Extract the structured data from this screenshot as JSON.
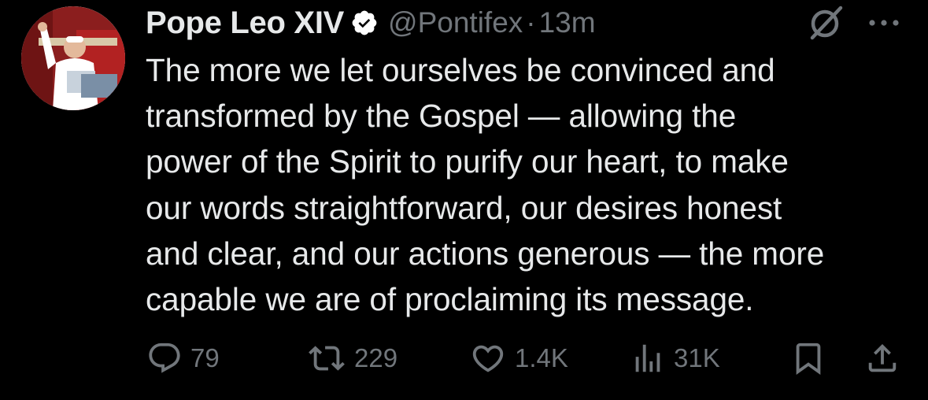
{
  "tweet": {
    "author": {
      "name": "Pope Leo XIV",
      "handle": "@Pontifex",
      "separator": "·",
      "time": "13m",
      "avatar_icon": "avatar-photo",
      "verified_icon": "verified-badge-icon"
    },
    "text_lines": [
      "The more we let ourselves be convinced and",
      "transformed by the Gospel — allowing the",
      "power of the Spirit to purify our heart, to make",
      "our words straightforward, our desires honest",
      "and clear, and our actions generous — the more",
      "capable we are of proclaiming its message."
    ],
    "actions": {
      "reply": {
        "icon": "reply-icon",
        "count": "79"
      },
      "retweet": {
        "icon": "retweet-icon",
        "count": "229"
      },
      "like": {
        "icon": "heart-icon",
        "count": "1.4K"
      },
      "views": {
        "icon": "analytics-icon",
        "count": "31K"
      },
      "bookmark": {
        "icon": "bookmark-icon"
      },
      "share": {
        "icon": "share-icon"
      }
    },
    "header_icons": {
      "grok": "grok-icon",
      "more": "more-icon"
    }
  },
  "colors": {
    "background": "#000000",
    "primary_text": "#e7e9ea",
    "secondary_text": "#71767b",
    "verified": "#ffffff"
  }
}
